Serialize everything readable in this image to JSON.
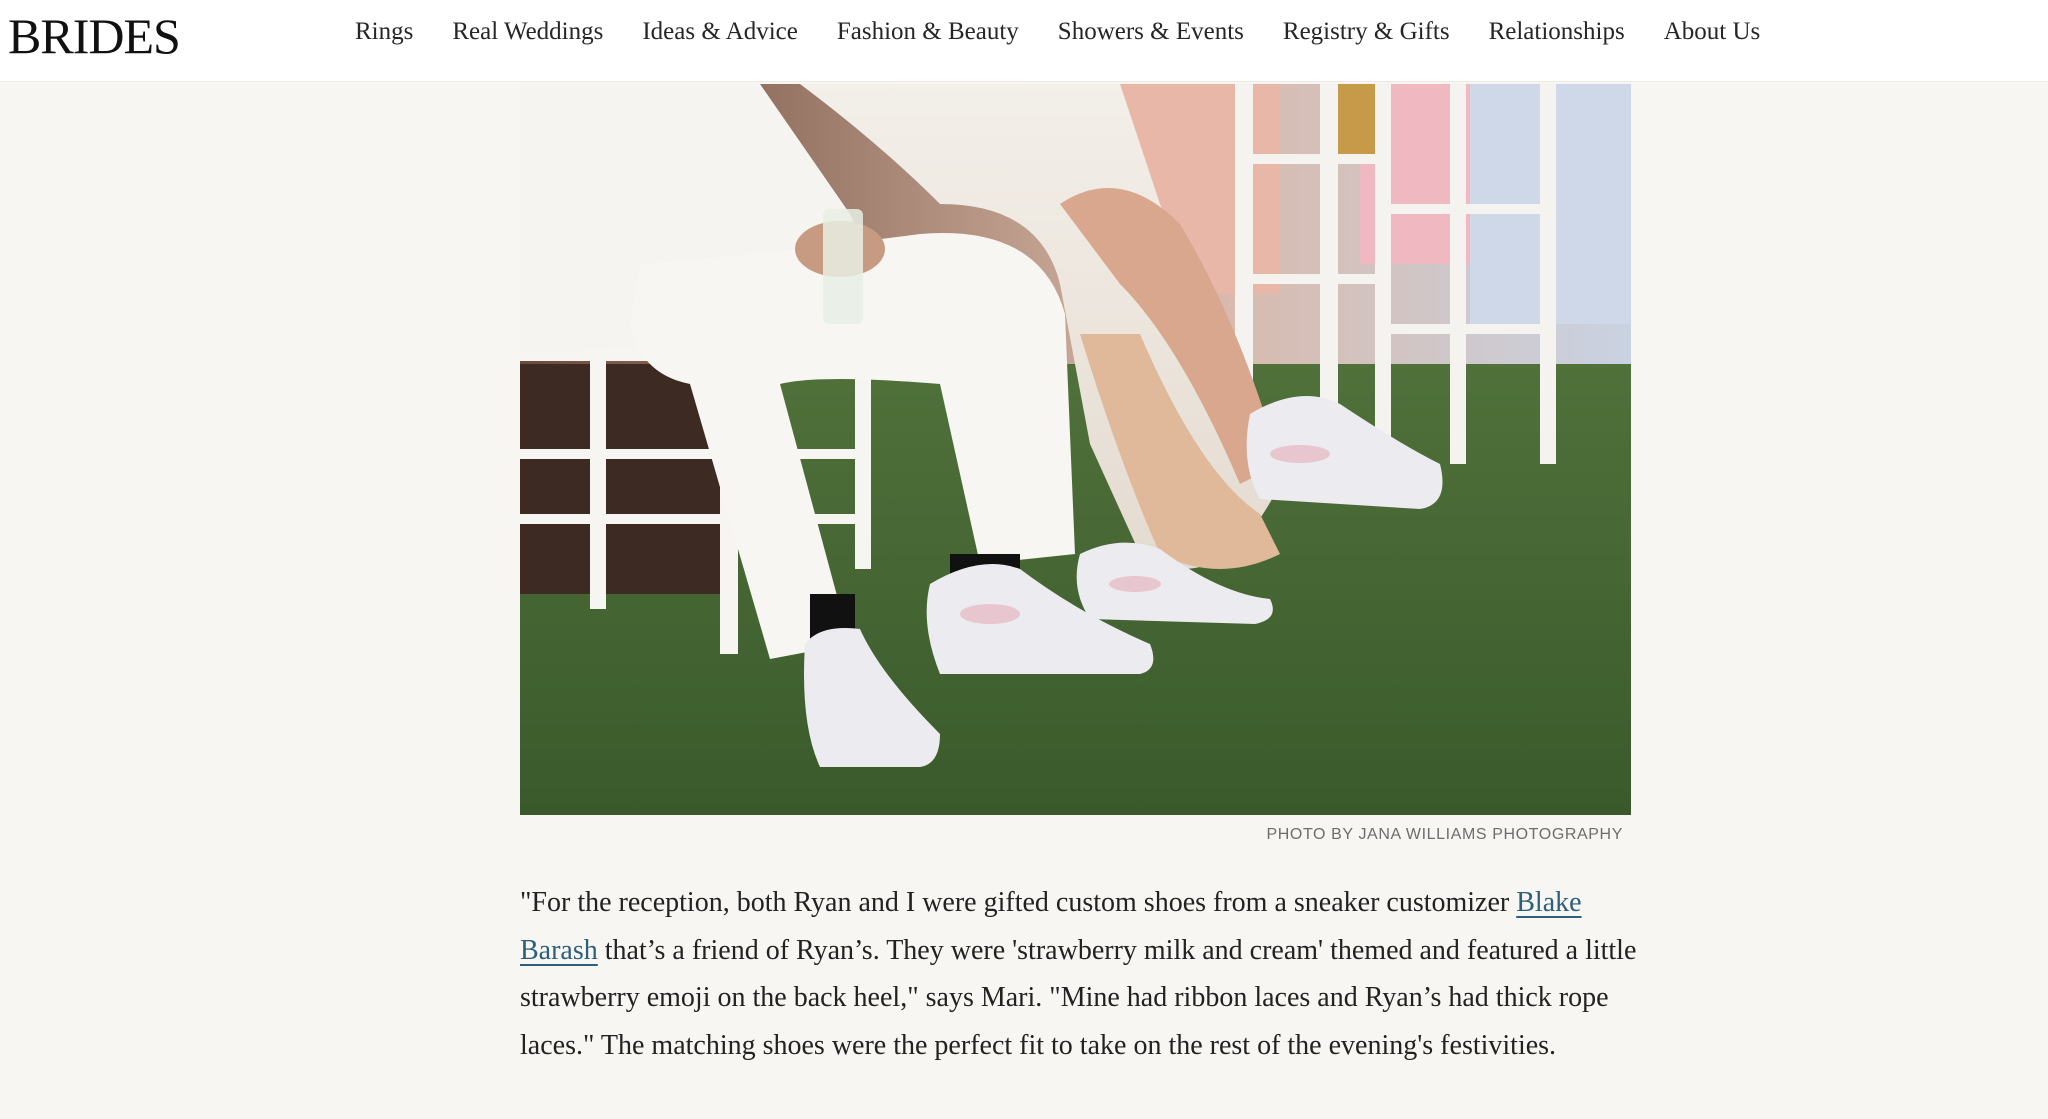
{
  "site": {
    "logo": "BRIDES"
  },
  "nav": {
    "items": [
      "Rings",
      "Real Weddings",
      "Ideas & Advice",
      "Fashion & Beauty",
      "Showers & Events",
      "Registry & Gifts",
      "Relationships",
      "About Us"
    ]
  },
  "photo": {
    "caption": "PHOTO BY JANA WILLIAMS PHOTOGRAPHY"
  },
  "article": {
    "paragraph_before_link": "\"For the reception, both Ryan and I were gifted custom shoes from a sneaker customizer ",
    "link_text": "Blake Barash",
    "paragraph_after_link": " that’s a friend of Ryan’s. They were 'strawberry milk and cream' themed and featured a little strawberry emoji on the back heel,\" says Mari. \"Mine had ribbon laces and Ryan’s had thick rope laces.\" The matching shoes were the perfect fit to take on the rest of the evening's festivities."
  },
  "colors": {
    "page_background": "#f8f6f2",
    "header_background": "#ffffff",
    "link": "#2c5f7c",
    "caption": "#6d6d6d"
  }
}
